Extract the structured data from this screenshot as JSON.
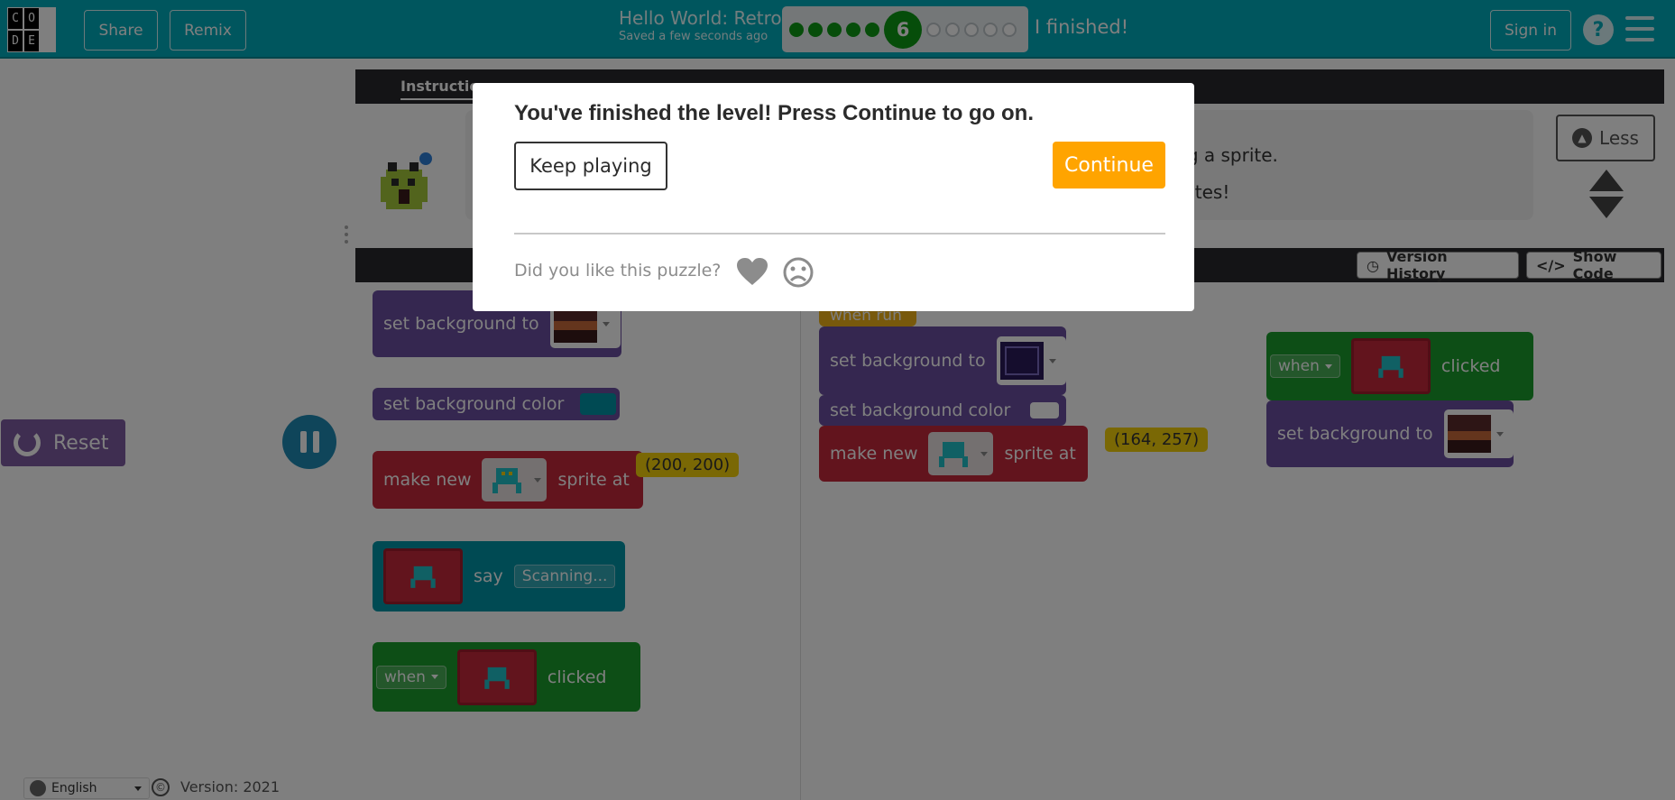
{
  "header": {
    "logo_letters": [
      "C",
      "O",
      "",
      "D",
      "E",
      ""
    ],
    "share_label": "Share",
    "remix_label": "Remix",
    "project_title": "Hello World: Retro",
    "saved_text": "Saved a few seconds ago",
    "current_level": "6",
    "completed_levels": 5,
    "remaining_levels": 5,
    "finished_label": "I finished!",
    "signin_label": "Sign in",
    "help_glyph": "?"
  },
  "colors": {
    "header": "#00adbc",
    "continue": "#ffa400",
    "purple_block": "#6a4fa0",
    "red_block": "#c5283a",
    "green_block": "#1b9c2d",
    "teal_block": "#0094a6",
    "yellow_block": "#f4d10b"
  },
  "instructions": {
    "tab_label": "Instructions",
    "line1": "king a sprite.",
    "line2": "rites!",
    "less_label": "Less"
  },
  "workspace_header": {
    "version_history_label": "Version History",
    "show_code_label": "Show Code"
  },
  "toolbox": {
    "set_background_to": "set background to",
    "set_background_color": "set background color",
    "make_new": "make new",
    "sprite_at": "sprite at",
    "coord": "(200, 200)",
    "say": "say",
    "say_text": "Scanning...",
    "when": "when",
    "clicked": "clicked"
  },
  "canvas": {
    "when_run": "when run",
    "set_background_to": "set background to",
    "set_background_color": "set background color",
    "make_new": "make new",
    "sprite_at": "sprite at",
    "coord": "(164, 257)",
    "when": "when",
    "clicked": "clicked",
    "set_background_to_2": "set background to"
  },
  "controls": {
    "reset_label": "Reset"
  },
  "footer": {
    "language": "English",
    "copyright_glyph": "©",
    "version": "Version: 2021"
  },
  "dialog": {
    "title": "You've finished the level! Press Continue to go on.",
    "keep_playing_label": "Keep playing",
    "continue_label": "Continue",
    "feedback_question": "Did you like this puzzle?"
  }
}
